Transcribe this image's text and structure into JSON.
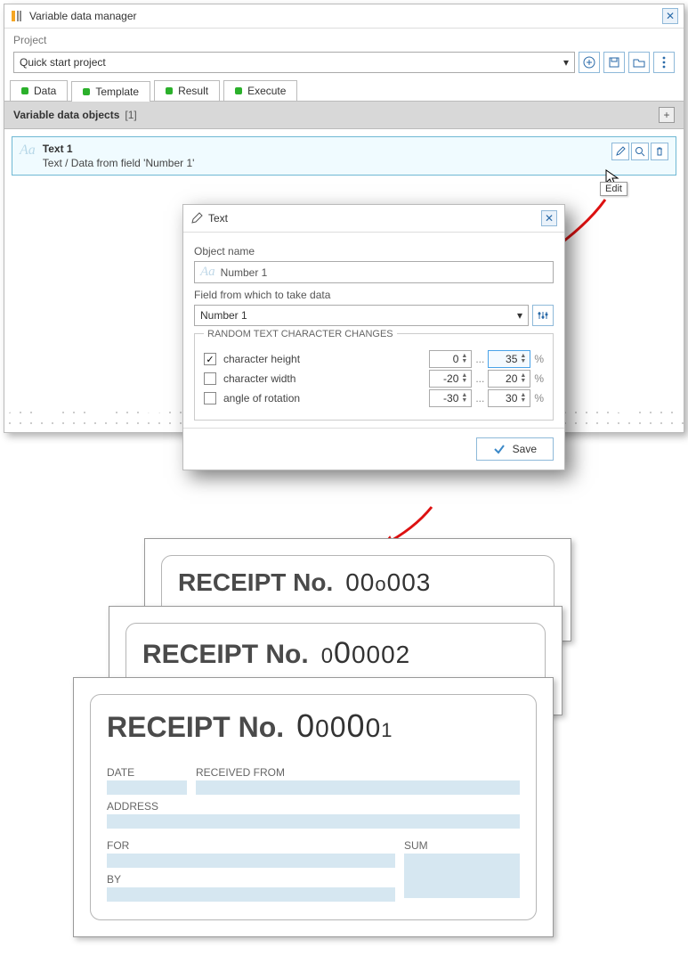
{
  "window": {
    "title": "Variable data manager"
  },
  "project": {
    "label": "Project",
    "value": "Quick start project"
  },
  "tabs": [
    {
      "label": "Data"
    },
    {
      "label": "Template",
      "active": true
    },
    {
      "label": "Result"
    },
    {
      "label": "Execute"
    }
  ],
  "vdo": {
    "title": "Variable data objects",
    "count": "[1]"
  },
  "item": {
    "name": "Text 1",
    "sub": "Text / Data from field 'Number 1'"
  },
  "tooltip": "Edit",
  "popup": {
    "title": "Text",
    "object_name_label": "Object name",
    "object_name": "Number 1",
    "field_label": "Field from which to take data",
    "field_value": "Number 1",
    "fieldset_legend": "RANDOM TEXT CHARACTER CHANGES",
    "params": [
      {
        "label": "character height",
        "checked": true,
        "from": "0",
        "to": "35"
      },
      {
        "label": "character width",
        "checked": false,
        "from": "-20",
        "to": "20"
      },
      {
        "label": "angle of rotation",
        "checked": false,
        "from": "-30",
        "to": "30"
      }
    ],
    "ellipsis": "...",
    "pct": "%",
    "save": "Save"
  },
  "receipts": {
    "label": "RECEIPT No.",
    "nums": [
      "00o003",
      "000002",
      "000001"
    ],
    "date": "DATE",
    "received": "RECEIVED FROM",
    "address": "ADDRESS",
    "for": "FOR",
    "sum": "SUM",
    "by": "BY"
  }
}
